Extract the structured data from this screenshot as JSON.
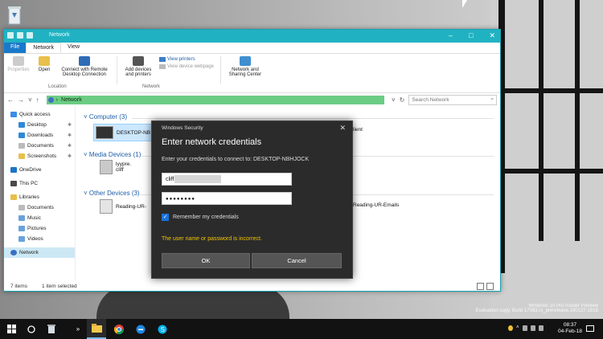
{
  "explorer": {
    "title": "Network",
    "tabs": [
      "File",
      "Network",
      "View"
    ],
    "ribbon": {
      "location_buttons": [
        "Properties",
        "Open",
        "Connect with Remote Desktop Connection"
      ],
      "location_group": "Location",
      "network_buttons": [
        "Add devices and printers",
        "View printers",
        "View device webpage",
        "Network and Sharing Center"
      ],
      "network_group": "Network"
    },
    "address": "Network",
    "search_placeholder": "Search Network",
    "nav": [
      {
        "label": "Quick access",
        "icon": "star-icon"
      },
      {
        "label": "Desktop",
        "icon": "desktop-folder-icon"
      },
      {
        "label": "Downloads",
        "icon": "downloads-folder-icon"
      },
      {
        "label": "Documents",
        "icon": "documents-folder-icon"
      },
      {
        "label": "Screenshots",
        "icon": "folder-icon"
      },
      {
        "label": "OneDrive",
        "icon": "cloud-icon"
      },
      {
        "label": "This PC",
        "icon": "computer-icon"
      },
      {
        "label": "Libraries",
        "icon": "libraries-icon"
      },
      {
        "label": "Documents",
        "icon": "documents-folder-icon"
      },
      {
        "label": "Music",
        "icon": "music-folder-icon"
      },
      {
        "label": "Pictures",
        "icon": "pictures-folder-icon"
      },
      {
        "label": "Videos",
        "icon": "videos-folder-icon"
      },
      {
        "label": "Network",
        "icon": "network-icon"
      }
    ],
    "groups": {
      "computer": "Computer (3)",
      "media": "Media Devices (1)",
      "other": "Other Devices (3)"
    },
    "items": {
      "desktop_pc": "DESKTOP-NB",
      "client": "lient",
      "media_line1": "lyypre.",
      "media_line2": "cliff",
      "reading1": "Reading-UR-",
      "reading2": "Reading-UR-Emails"
    },
    "status": {
      "count": "7 items",
      "selected": "1 item selected"
    }
  },
  "dialog": {
    "app": "Windows Security",
    "close": "✕",
    "heading": "Enter network credentials",
    "prompt": "Enter your credentials to connect to: DESKTOP-NBHJOCK",
    "username": "cliff",
    "password": "●●●●●●●●",
    "remember": "Remember my credentials",
    "error": "The user name or password is incorrect.",
    "ok": "OK",
    "cancel": "Cancel"
  },
  "desktop": {
    "watermark_line1": "Windows 10 Pro Insider Preview",
    "watermark_line2": "Evaluation copy. Build 17083.rs_prerelease.180127-1818"
  },
  "taskbar": {
    "time": "08:37",
    "date": "04-Feb-18",
    "accent": "#7ab8f0"
  },
  "colors": {
    "titlebar": "#20b2c2",
    "address_highlight": "#6bcd84",
    "error": "#f3c300",
    "checkbox": "#1a73d9"
  }
}
